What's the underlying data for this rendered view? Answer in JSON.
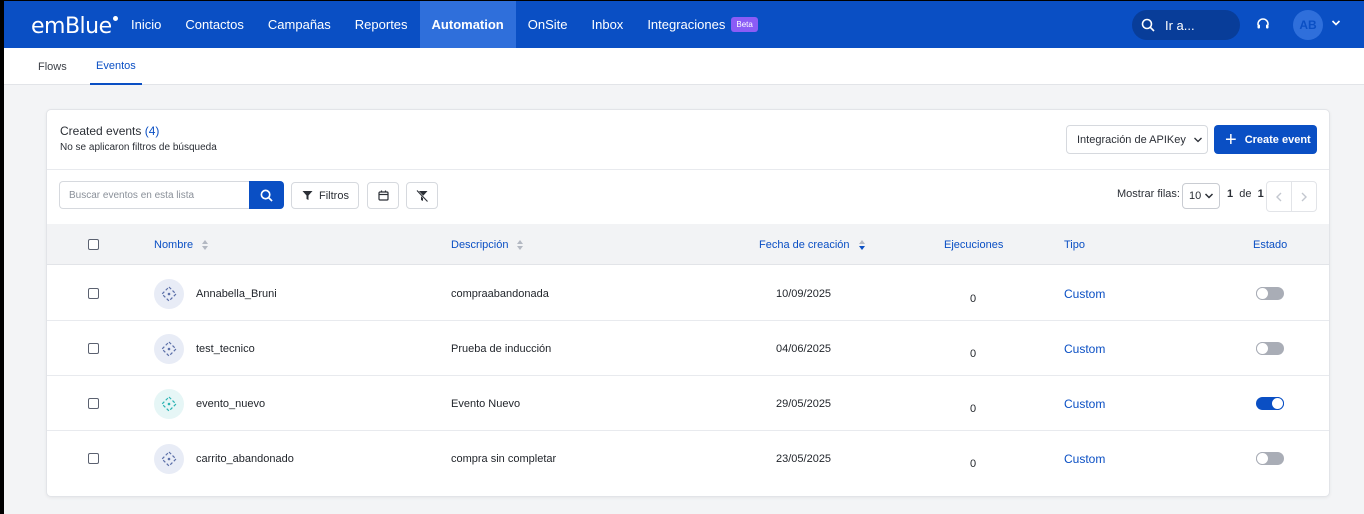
{
  "brand": {
    "logo_text": "emBlue"
  },
  "nav": {
    "items": [
      {
        "label": "Inicio",
        "active": false
      },
      {
        "label": "Contactos",
        "active": false
      },
      {
        "label": "Campañas",
        "active": false
      },
      {
        "label": "Reportes",
        "active": false
      },
      {
        "label": "Automation",
        "active": true
      },
      {
        "label": "OnSite",
        "active": false
      },
      {
        "label": "Inbox",
        "active": false
      },
      {
        "label": "Integraciones",
        "active": false
      }
    ],
    "beta_badge": "Beta",
    "search_placeholder": "Ir a...",
    "avatar_initials": "AB"
  },
  "subnav": {
    "tabs": [
      {
        "label": "Flows",
        "active": false
      },
      {
        "label": "Eventos",
        "active": true
      }
    ]
  },
  "card": {
    "title": "Created events",
    "count": "(4)",
    "subtitle": "No se aplicaron filtros de búsqueda",
    "apikey_label": "Integración de APIKey",
    "create_label": "Create event"
  },
  "toolbar": {
    "search_placeholder": "Buscar eventos en esta lista",
    "filters_label": "Filtros",
    "rows_label": "Mostrar filas:",
    "rows_value": "10",
    "page_current": "1",
    "page_of": "de",
    "page_total": "1"
  },
  "table": {
    "headers": {
      "name": "Nombre",
      "description": "Descripción",
      "created": "Fecha de creación",
      "executions": "Ejecuciones",
      "type": "Tipo",
      "status": "Estado"
    },
    "rows": [
      {
        "name": "Annabella_Bruni",
        "description": "compraabandonada",
        "created": "10/09/2025",
        "executions": "0",
        "type": "Custom",
        "active": false,
        "icon_color": "#5b6fa8"
      },
      {
        "name": "test_tecnico",
        "description": "Prueba de inducción",
        "created": "04/06/2025",
        "executions": "0",
        "type": "Custom",
        "active": false,
        "icon_color": "#5b6fa8"
      },
      {
        "name": "evento_nuevo",
        "description": "Evento Nuevo",
        "created": "29/05/2025",
        "executions": "0",
        "type": "Custom",
        "active": true,
        "icon_color": "#2bb3b3"
      },
      {
        "name": "carrito_abandonado",
        "description": "compra sin completar",
        "created": "23/05/2025",
        "executions": "0",
        "type": "Custom",
        "active": false,
        "icon_color": "#5b6fa8"
      }
    ]
  },
  "colors": {
    "primary": "#0a4fc4",
    "toggle_off": "#a9adb6",
    "beta": "#8b5cf6"
  }
}
